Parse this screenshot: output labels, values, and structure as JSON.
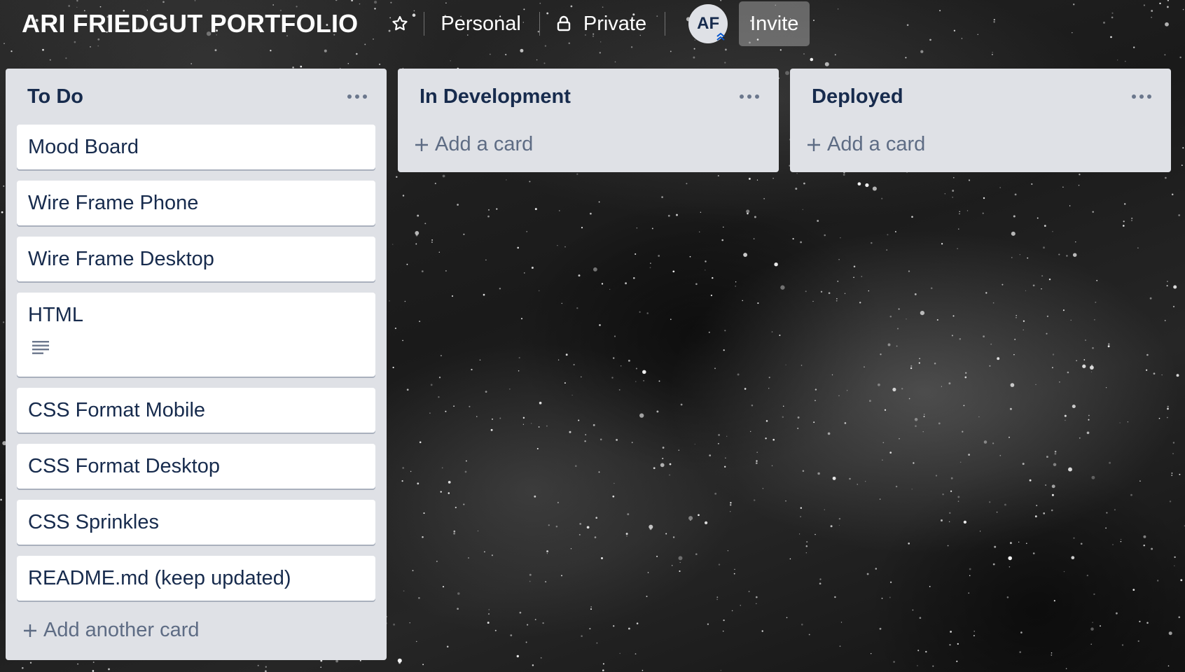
{
  "board": {
    "title": "ARI FRIEDGUT PORTFOLIO",
    "team_label": "Personal",
    "visibility_label": "Private",
    "avatar_initials": "AF",
    "invite_label": "Invite"
  },
  "lists": [
    {
      "title": "To Do",
      "cards": [
        "Mood Board",
        "Wire Frame Phone",
        "Wire Frame Desktop",
        "HTML",
        "CSS Format Mobile",
        "CSS Format Desktop",
        "CSS Sprinkles",
        "README.md (keep updated)"
      ],
      "add_label": "Add another card"
    },
    {
      "title": "In Development",
      "cards": [],
      "add_label": "Add a card"
    },
    {
      "title": "Deployed",
      "cards": [],
      "add_label": "Add a card"
    }
  ],
  "icons": {
    "star": "star-icon",
    "lock": "lock-icon",
    "menu": "more-icon",
    "plus": "plus-icon",
    "description": "description-icon",
    "admin_badge": "chevron-up-double-icon"
  },
  "colors": {
    "list_bg": "#dfe1e6",
    "card_bg": "#ffffff",
    "text_primary": "#172b4d",
    "text_secondary": "#5e6c84"
  }
}
